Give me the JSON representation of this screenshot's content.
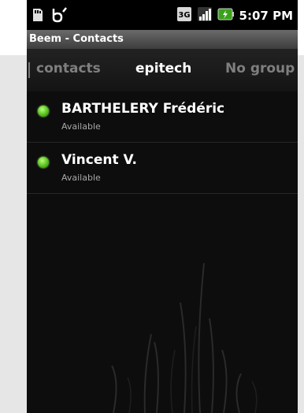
{
  "statusbar": {
    "time": "5:07 PM",
    "network_badge": "3G",
    "icons": [
      "sd-card-icon",
      "beem-notification-icon",
      "network-3g-icon",
      "signal-icon",
      "battery-charging-icon"
    ]
  },
  "app": {
    "title": "Beem - Contacts"
  },
  "groups": {
    "tabs": [
      {
        "label": "contacts"
      },
      {
        "label": "epitech",
        "active": true
      },
      {
        "label": "No group"
      }
    ]
  },
  "contacts": [
    {
      "name": "BARTHELERY Frédéric",
      "status": "Available"
    },
    {
      "name": "Vincent V.",
      "status": "Available"
    }
  ],
  "colors": {
    "available": "#56c11d",
    "background": "#0d0d0d",
    "tab_active": "#ffffff",
    "tab_inactive": "#7f7f7f"
  }
}
